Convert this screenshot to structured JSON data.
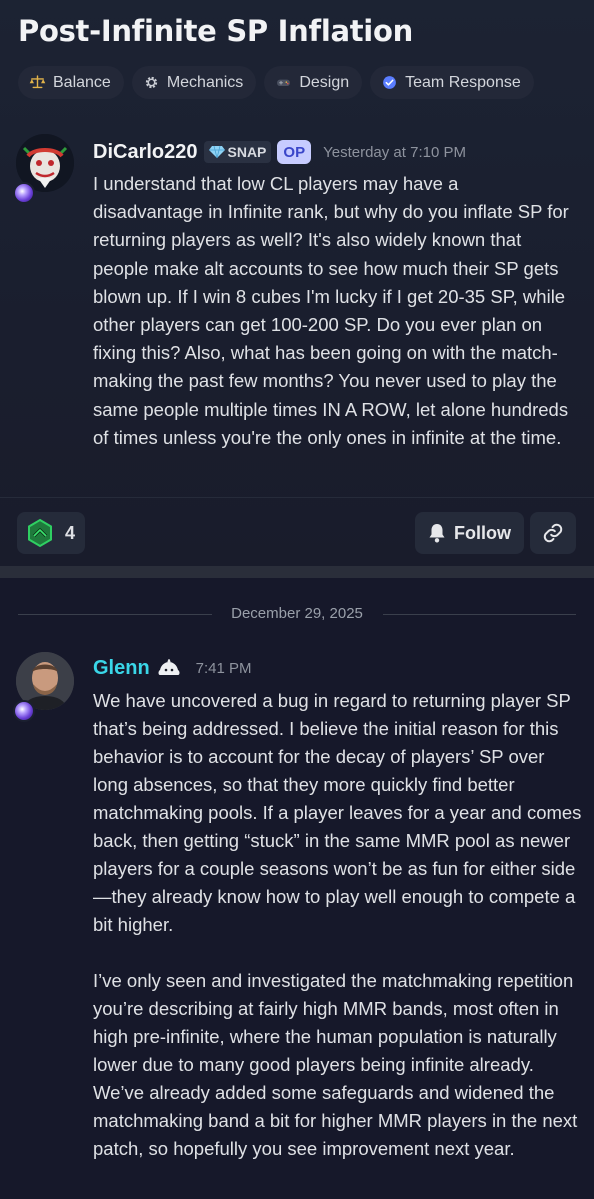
{
  "thread": {
    "title": "Post-Infinite SP Inflation",
    "tags": [
      {
        "icon": "balance-scale-icon",
        "label": "Balance"
      },
      {
        "icon": "gear-icon",
        "label": "Mechanics"
      },
      {
        "icon": "gamepad-icon",
        "label": "Design"
      },
      {
        "icon": "check-badge-icon",
        "label": "Team Response"
      }
    ]
  },
  "post": {
    "author": "DiCarlo220",
    "snap_badge": "SNAP",
    "op_badge": "OP",
    "timestamp": "Yesterday at 7:10 PM",
    "body": "I understand that low CL players may have a disadvantage in Infinite rank, but why do you inflate SP for returning players as well? It's also widely known that people make alt accounts to see how much their SP gets blown up. If I win 8 cubes I'm lucky if I get 20-35 SP, while other players can get 100-200 SP. Do you ever plan on fixing this? Also, what has been going on with the match-making the past few months? You never used to play the same people multiple times IN A ROW, let alone hundreds of times unless you're the only ones in infinite at the time.",
    "reaction_count": "4",
    "follow_label": "Follow"
  },
  "date_separator": "December 29, 2025",
  "reply": {
    "author": "Glenn",
    "timestamp": "7:41 PM",
    "paragraphs": [
      "We have uncovered a bug in regard to returning player SP that’s being addressed. I believe the initial reason for this behavior is to account for the decay of players’ SP over long absences, so that they more quickly find better matchmaking pools. If a player leaves for a year and comes back, then getting “stuck” in the same MMR pool as newer players for a couple seasons won’t be as fun for either side—they already know how to play well enough to compete a bit higher.",
      "I’ve only seen and investigated the matchmaking repetition you’re describing at fairly high MMR bands, most often in high pre-infinite, where the human population is naturally lower due to many good players being infinite already. We’ve already added some safeguards and widened the matchmaking band a bit for higher MMR players in the next patch, so hopefully you see improvement next year."
    ]
  },
  "colors": {
    "accent_blue": "#5865f2",
    "reply_name": "#3ad6e8",
    "reaction_green": "#23a55a"
  }
}
